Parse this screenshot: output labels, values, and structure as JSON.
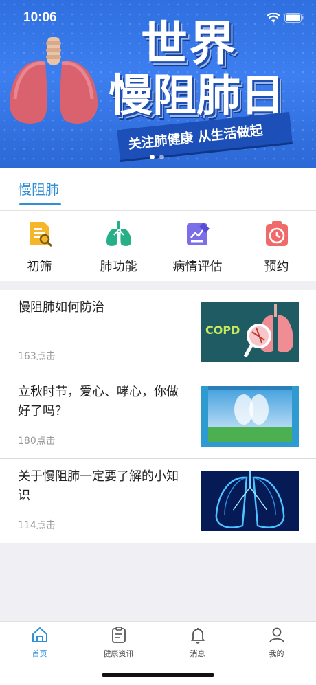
{
  "status_bar": {
    "time": "10:06"
  },
  "banner": {
    "title_line1": "世界",
    "title_line2": "慢阻肺日",
    "slogan": "关注肺健康 从生活做起",
    "page_count": 2,
    "active_page": 1
  },
  "category": {
    "tab_label": "慢阻肺"
  },
  "functions": [
    {
      "label": "初筛",
      "icon": "screening-doc-icon"
    },
    {
      "label": "肺功能",
      "icon": "lungs-icon"
    },
    {
      "label": "病情评估",
      "icon": "assessment-chart-icon"
    },
    {
      "label": "预约",
      "icon": "appointment-clock-icon"
    }
  ],
  "news": [
    {
      "title": "慢阻肺如何防治",
      "clicks": "163点击",
      "thumb_text": "COPD"
    },
    {
      "title": "立秋时节，爱心、哮心，你做好了吗？",
      "clicks": "180点击"
    },
    {
      "title": "关于慢阻肺一定要了解的小知识",
      "clicks": "114点击"
    }
  ],
  "bottom_nav": [
    {
      "label": "首页",
      "icon": "home-icon",
      "active": true
    },
    {
      "label": "健康资讯",
      "icon": "clipboard-icon",
      "active": false
    },
    {
      "label": "消息",
      "icon": "bell-icon",
      "active": false
    },
    {
      "label": "我的",
      "icon": "user-icon",
      "active": false
    }
  ],
  "colors": {
    "accent": "#2f8fd8",
    "banner_blue": "#3d7ff0"
  }
}
